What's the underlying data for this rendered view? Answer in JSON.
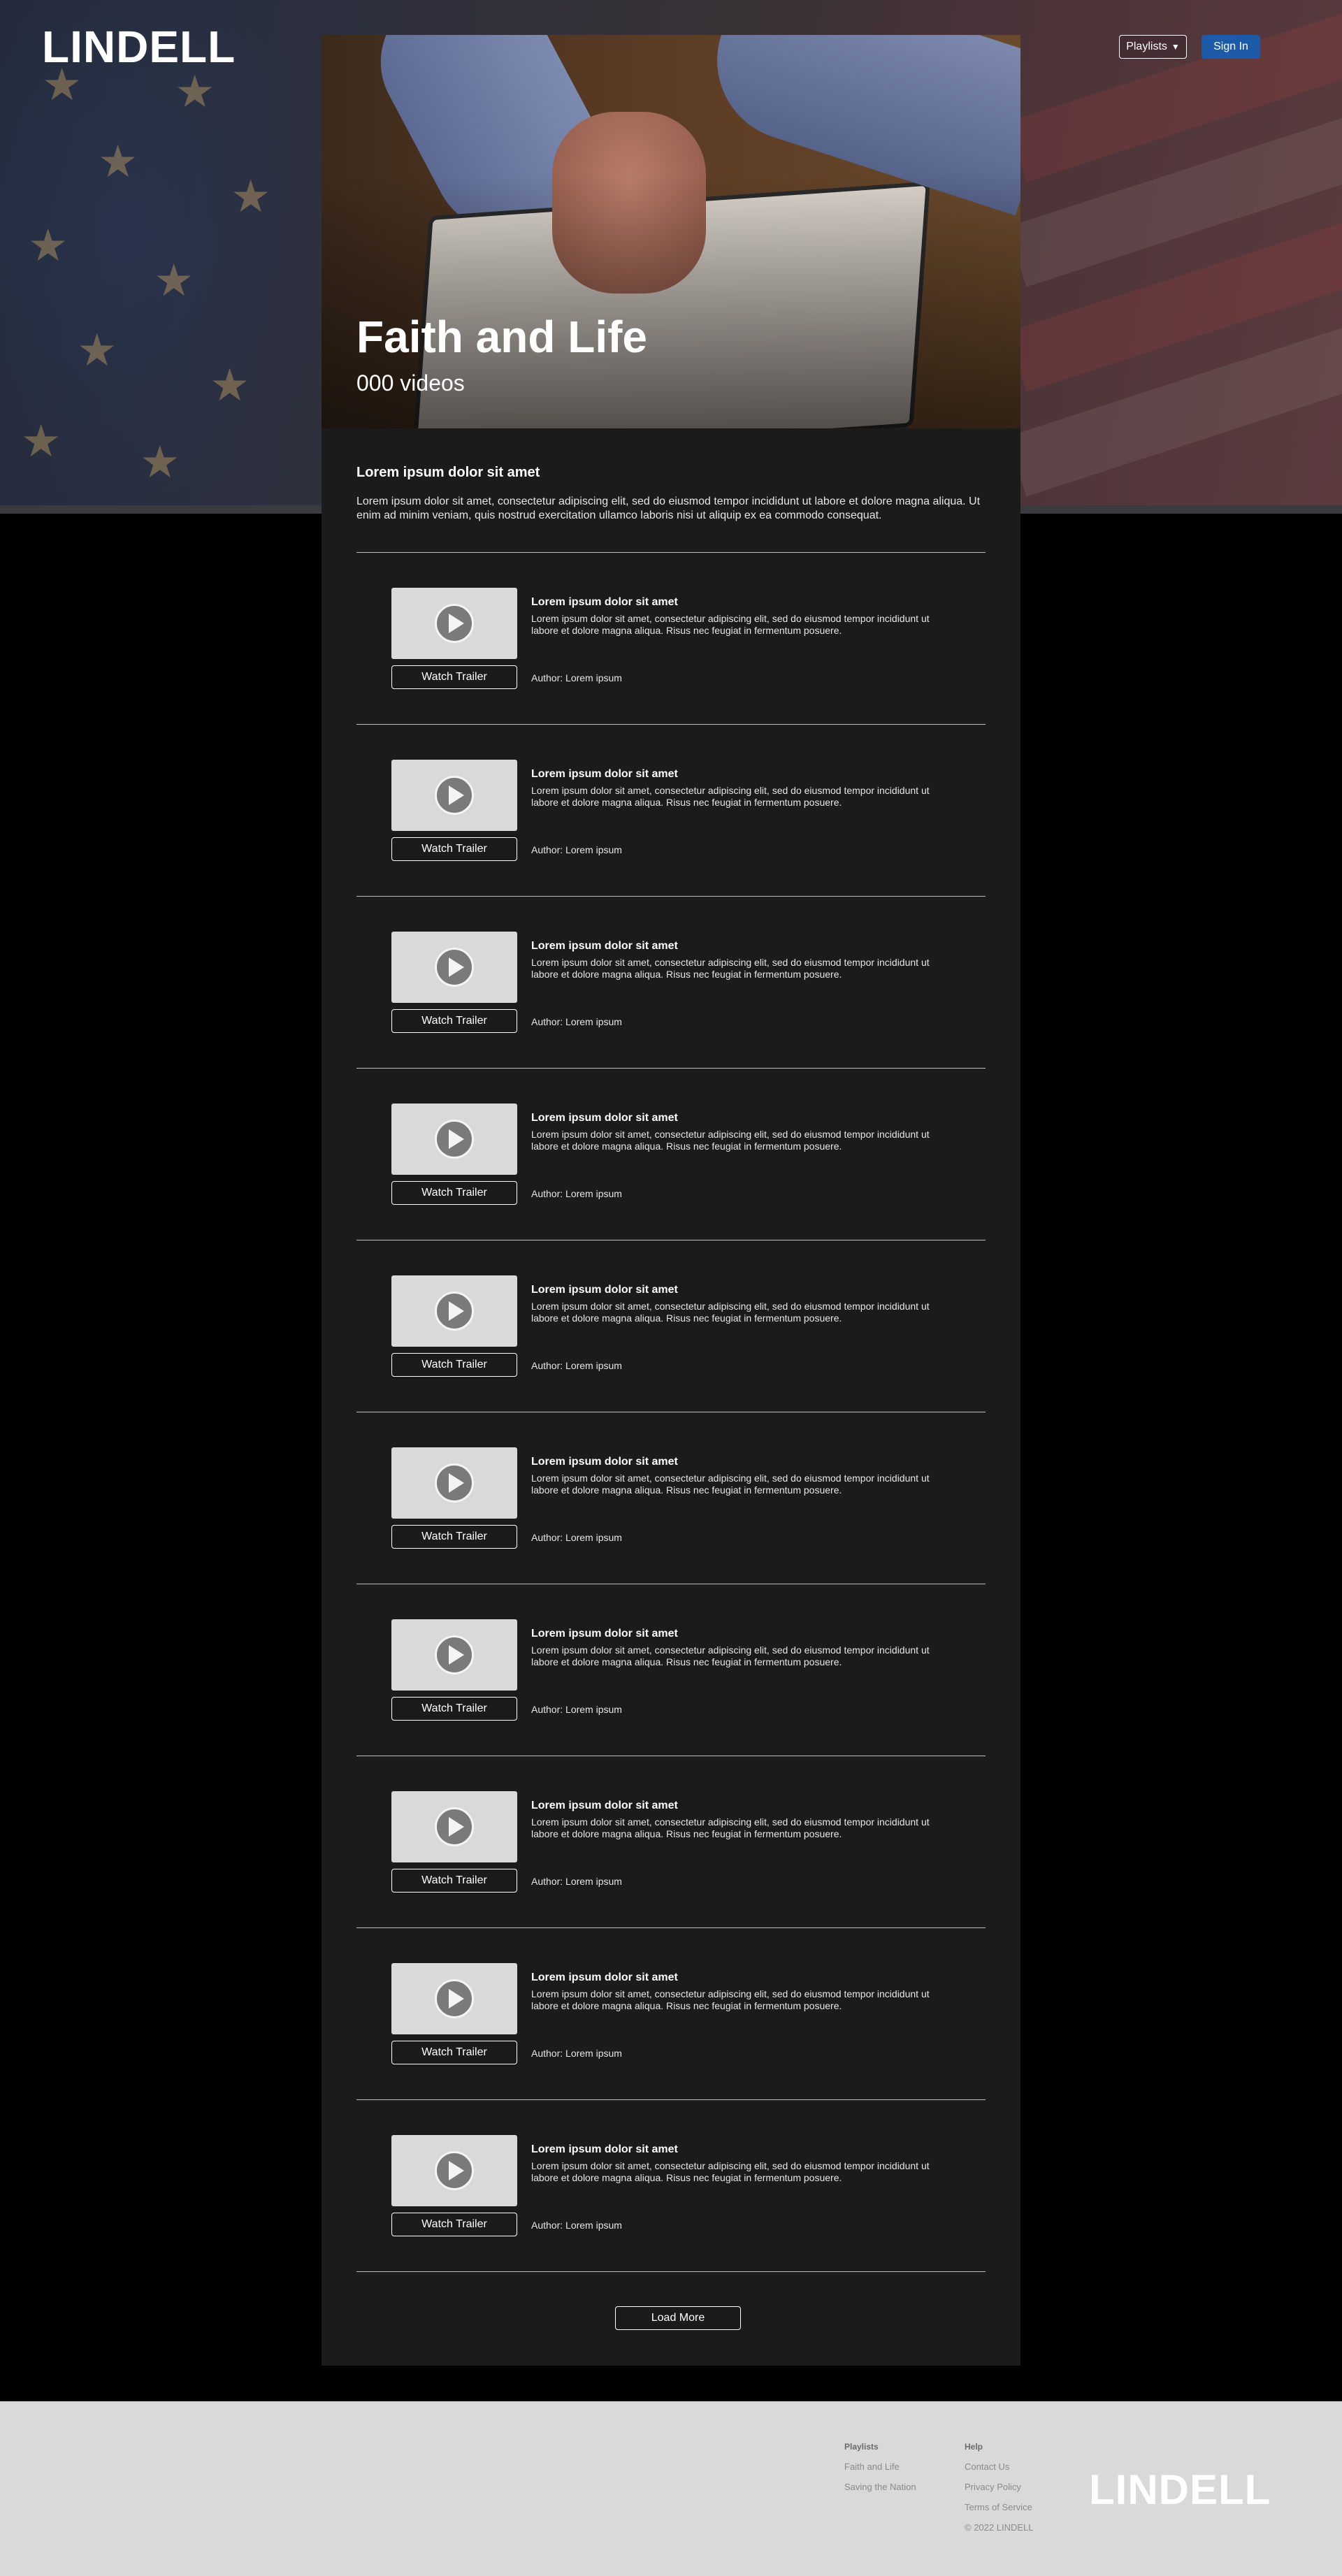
{
  "header": {
    "logo": "LINDELL",
    "playlists_label": "Playlists",
    "signin_label": "Sign In"
  },
  "hero": {
    "title": "Faith and Life",
    "count": "000 videos"
  },
  "intro": {
    "heading": "Lorem ipsum dolor sit amet",
    "text": "Lorem ipsum dolor sit amet, consectetur adipiscing elit, sed do eiusmod tempor incididunt ut labore et dolore magna aliqua. Ut enim ad minim veniam, quis nostrud exercitation ullamco laboris nisi ut aliquip ex ea commodo consequat."
  },
  "videos": [
    {
      "title": "Lorem ipsum dolor sit amet",
      "description": "Lorem ipsum dolor sit amet, consectetur adipiscing elit, sed do eiusmod tempor incididunt ut labore et dolore magna aliqua. Risus nec feugiat in fermentum posuere.",
      "author": "Author: Lorem ipsum",
      "button": "Watch Trailer"
    },
    {
      "title": "Lorem ipsum dolor sit amet",
      "description": "Lorem ipsum dolor sit amet, consectetur adipiscing elit, sed do eiusmod tempor incididunt ut labore et dolore magna aliqua. Risus nec feugiat in fermentum posuere.",
      "author": "Author: Lorem ipsum",
      "button": "Watch Trailer"
    },
    {
      "title": "Lorem ipsum dolor sit amet",
      "description": "Lorem ipsum dolor sit amet, consectetur adipiscing elit, sed do eiusmod tempor incididunt ut labore et dolore magna aliqua. Risus nec feugiat in fermentum posuere.",
      "author": "Author: Lorem ipsum",
      "button": "Watch Trailer"
    },
    {
      "title": "Lorem ipsum dolor sit amet",
      "description": "Lorem ipsum dolor sit amet, consectetur adipiscing elit, sed do eiusmod tempor incididunt ut labore et dolore magna aliqua. Risus nec feugiat in fermentum posuere.",
      "author": "Author: Lorem ipsum",
      "button": "Watch Trailer"
    },
    {
      "title": "Lorem ipsum dolor sit amet",
      "description": "Lorem ipsum dolor sit amet, consectetur adipiscing elit, sed do eiusmod tempor incididunt ut labore et dolore magna aliqua. Risus nec feugiat in fermentum posuere.",
      "author": "Author: Lorem ipsum",
      "button": "Watch Trailer"
    },
    {
      "title": "Lorem ipsum dolor sit amet",
      "description": "Lorem ipsum dolor sit amet, consectetur adipiscing elit, sed do eiusmod tempor incididunt ut labore et dolore magna aliqua. Risus nec feugiat in fermentum posuere.",
      "author": "Author: Lorem ipsum",
      "button": "Watch Trailer"
    },
    {
      "title": "Lorem ipsum dolor sit amet",
      "description": "Lorem ipsum dolor sit amet, consectetur adipiscing elit, sed do eiusmod tempor incididunt ut labore et dolore magna aliqua. Risus nec feugiat in fermentum posuere.",
      "author": "Author: Lorem ipsum",
      "button": "Watch Trailer"
    },
    {
      "title": "Lorem ipsum dolor sit amet",
      "description": "Lorem ipsum dolor sit amet, consectetur adipiscing elit, sed do eiusmod tempor incididunt ut labore et dolore magna aliqua. Risus nec feugiat in fermentum posuere.",
      "author": "Author: Lorem ipsum",
      "button": "Watch Trailer"
    },
    {
      "title": "Lorem ipsum dolor sit amet",
      "description": "Lorem ipsum dolor sit amet, consectetur adipiscing elit, sed do eiusmod tempor incididunt ut labore et dolore magna aliqua. Risus nec feugiat in fermentum posuere.",
      "author": "Author: Lorem ipsum",
      "button": "Watch Trailer"
    },
    {
      "title": "Lorem ipsum dolor sit amet",
      "description": "Lorem ipsum dolor sit amet, consectetur adipiscing elit, sed do eiusmod tempor incididunt ut labore et dolore magna aliqua. Risus nec feugiat in fermentum posuere.",
      "author": "Author: Lorem ipsum",
      "button": "Watch Trailer"
    }
  ],
  "load_more_label": "Load More",
  "footer": {
    "playlists_heading": "Playlists",
    "playlists_links": [
      "Faith and Life",
      "Saving the Nation"
    ],
    "help_heading": "Help",
    "help_links": [
      "Contact Us",
      "Privacy Policy",
      "Terms of Service"
    ],
    "copyright": "© 2022 LINDELL",
    "logo": "LINDELL"
  },
  "colors": {
    "signin_blue": "#1d5aa8",
    "card_bg": "#1b1b1b",
    "footer_bg": "#d9d9d9"
  },
  "icons": [
    "play-icon",
    "dropdown-arrow-icon"
  ]
}
